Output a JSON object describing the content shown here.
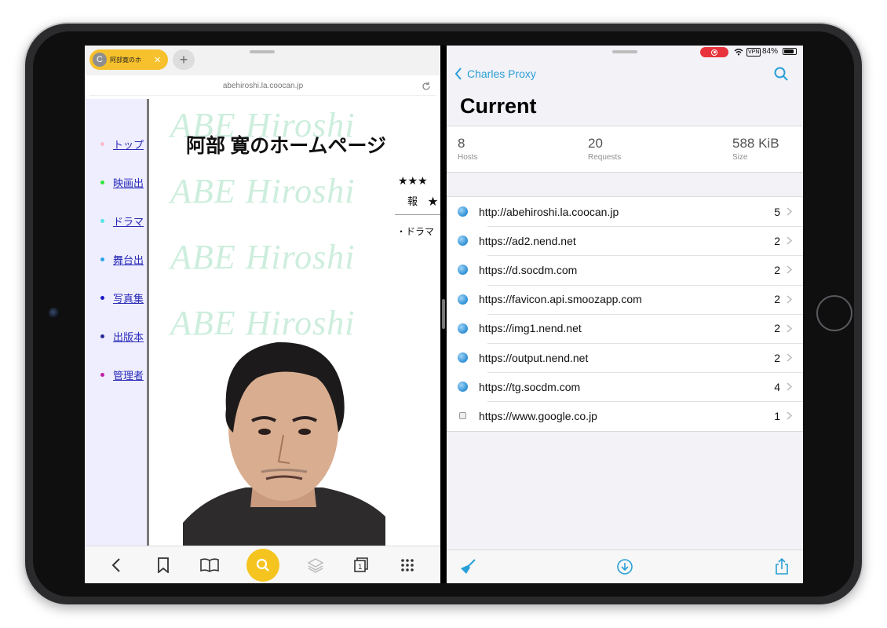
{
  "browser": {
    "tab_title": "阿部寛のホ",
    "tab_favicon_letter": "C",
    "url": "abehiroshi.la.coocan.jp",
    "nav": [
      {
        "label": "トップ",
        "color": "#ffbccb"
      },
      {
        "label": "映画出",
        "color": "#2ee838"
      },
      {
        "label": "ドラマ",
        "color": "#53e6e6"
      },
      {
        "label": "舞台出",
        "color": "#2aa3e6"
      },
      {
        "label": "写真集",
        "color": "#1a1ac4"
      },
      {
        "label": "出版本",
        "color": "#2a2a9a"
      },
      {
        "label": "管理者",
        "color": "#c020a8"
      }
    ],
    "watermark": "ABE Hiroshi",
    "heading": "阿部 寛のホームページ",
    "stars": "★★★",
    "info_line": "報　★",
    "drama_line": "・ドラマ"
  },
  "charles": {
    "back_label": "Charles Proxy",
    "title": "Current",
    "battery": "84%",
    "battery_level": 0.84,
    "vpn_label": "VPN",
    "stats": [
      {
        "value": "8",
        "label": "Hosts"
      },
      {
        "value": "20",
        "label": "Requests"
      },
      {
        "value": "588 KiB",
        "label": "Size"
      }
    ],
    "hosts": [
      {
        "url": "http://abehiroshi.la.coocan.jp",
        "count": "5",
        "icon": "globe-icon"
      },
      {
        "url": "https://ad2.nend.net",
        "count": "2",
        "icon": "globe-icon"
      },
      {
        "url": "https://d.socdm.com",
        "count": "2",
        "icon": "globe-icon"
      },
      {
        "url": "https://favicon.api.smoozapp.com",
        "count": "2",
        "icon": "globe-icon"
      },
      {
        "url": "https://img1.nend.net",
        "count": "2",
        "icon": "globe-icon"
      },
      {
        "url": "https://output.nend.net",
        "count": "2",
        "icon": "globe-icon"
      },
      {
        "url": "https://tg.socdm.com",
        "count": "4",
        "icon": "globe-icon"
      },
      {
        "url": "https://www.google.co.jp",
        "count": "1",
        "icon": "lock-icon"
      }
    ]
  },
  "colors": {
    "accent_blue": "#2a9fd6",
    "search_yellow": "#f5c41f",
    "record_red": "#e8323c"
  }
}
